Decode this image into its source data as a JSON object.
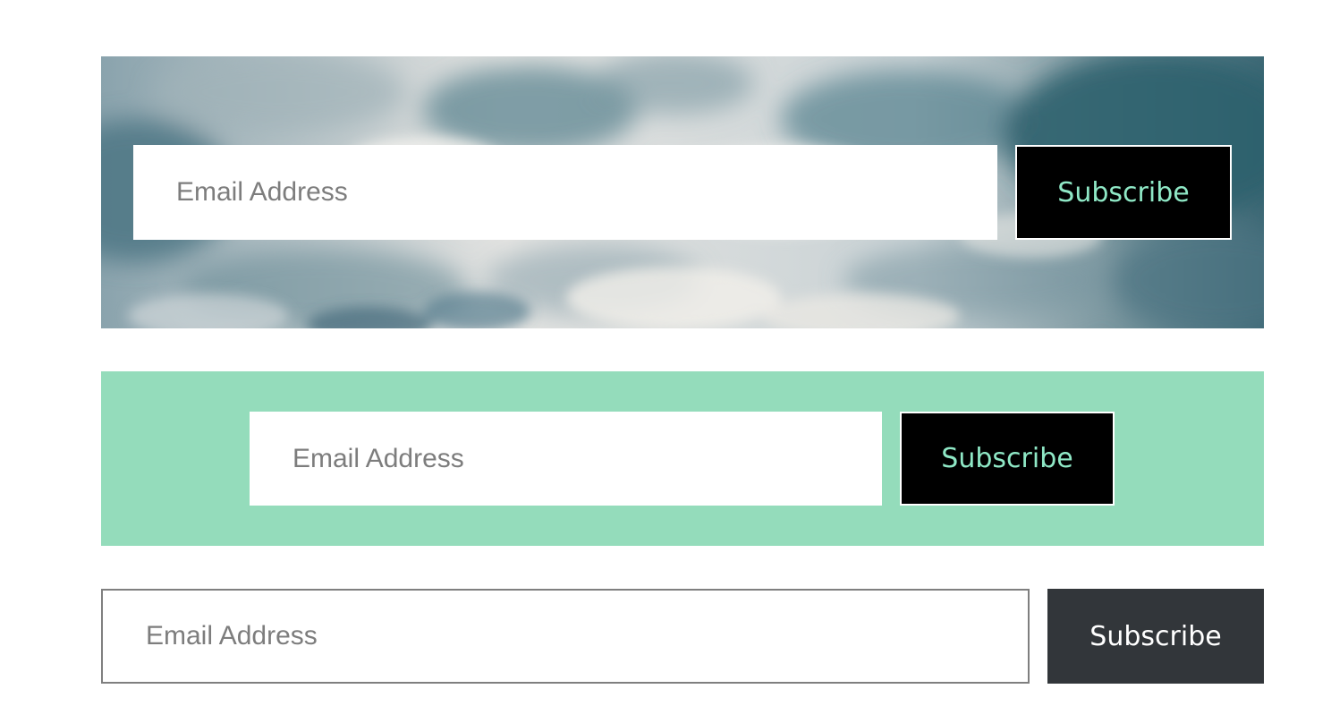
{
  "forms": [
    {
      "style": "cloud-image-background",
      "email_placeholder": "Email Address",
      "button_label": "Subscribe",
      "button_bg": "#000000",
      "button_text_color": "#8fe8c6"
    },
    {
      "style": "green-background",
      "background_color": "#94dcbb",
      "email_placeholder": "Email Address",
      "button_label": "Subscribe",
      "button_bg": "#000000",
      "button_text_color": "#8fe8c6"
    },
    {
      "style": "plain",
      "email_placeholder": "Email Address",
      "button_label": "Subscribe",
      "button_bg": "#32363a",
      "button_text_color": "#ffffff"
    }
  ]
}
